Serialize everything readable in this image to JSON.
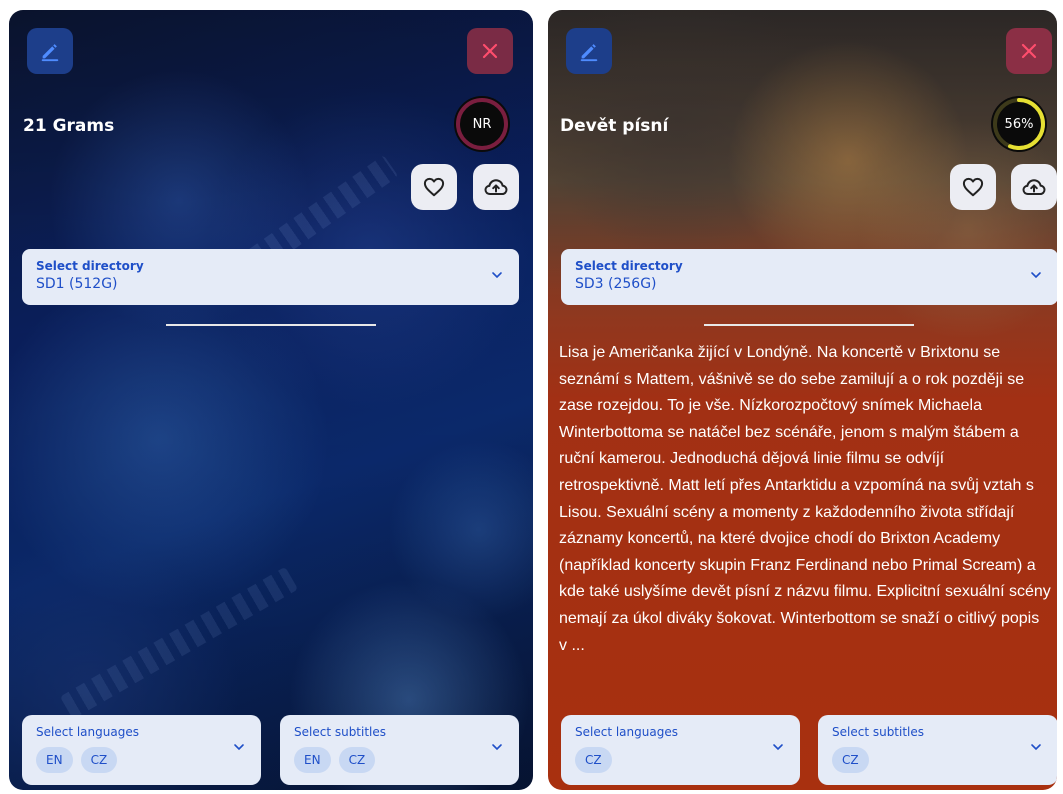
{
  "cards": [
    {
      "title": "21 Grams",
      "rating": {
        "label": "NR",
        "percent": 0,
        "ring_color": "#7a1e3f",
        "fill_color": "#7a1e3f"
      },
      "directory": {
        "label": "Select directory",
        "value": "SD1 (512G)"
      },
      "description": "",
      "languages": {
        "label": "Select languages",
        "chips": [
          "EN",
          "CZ"
        ]
      },
      "subtitles": {
        "label": "Select subtitles",
        "chips": [
          "EN",
          "CZ"
        ]
      },
      "icons": {
        "edit": "pencil-icon",
        "close": "close-icon",
        "favorite": "heart-icon",
        "upload": "cloud-upload-icon"
      }
    },
    {
      "title": "Devět písní",
      "rating": {
        "label": "56%",
        "percent": 56,
        "ring_color": "#3d3a1a",
        "fill_color": "#e6e033"
      },
      "directory": {
        "label": "Select directory",
        "value": "SD3 (256G)"
      },
      "description": "Lisa je Američanka žijící v Londýně. Na koncertě v Brixtonu se seznámí s Mattem, vášnivě se do sebe zamilují a o rok později se zase rozejdou. To je vše. Nízkorozpočtový snímek Michaela Winterbottoma se natáčel bez scénáře, jenom s malým štábem a ruční kamerou. Jednoduchá dějová linie filmu se odvíjí retrospektivně. Matt letí přes Antarktidu a vzpomíná na svůj vztah s Lisou. Sexuální scény a momenty z každodenního života střídají záznamy koncertů, na které dvojice chodí do Brixton Academy (například koncerty skupin Franz Ferdinand nebo Primal Scream) a kde také uslyšíme devět písní z názvu filmu. Explicitní sexuální scény nemají za úkol diváky šokovat. Winterbottom se snaží o citlivý popis v ...",
      "languages": {
        "label": "Select languages",
        "chips": [
          "CZ"
        ]
      },
      "subtitles": {
        "label": "Select subtitles",
        "chips": [
          "CZ"
        ]
      },
      "icons": {
        "edit": "pencil-icon",
        "close": "close-icon",
        "favorite": "heart-icon",
        "upload": "cloud-upload-icon"
      }
    }
  ],
  "colors": {
    "accent": "#1f4fc8",
    "select_bg": "#e5ebf7",
    "chip_bg": "#c8d8f3",
    "close_icon": "#ff4d6d",
    "edit_icon": "#4f8cff"
  }
}
